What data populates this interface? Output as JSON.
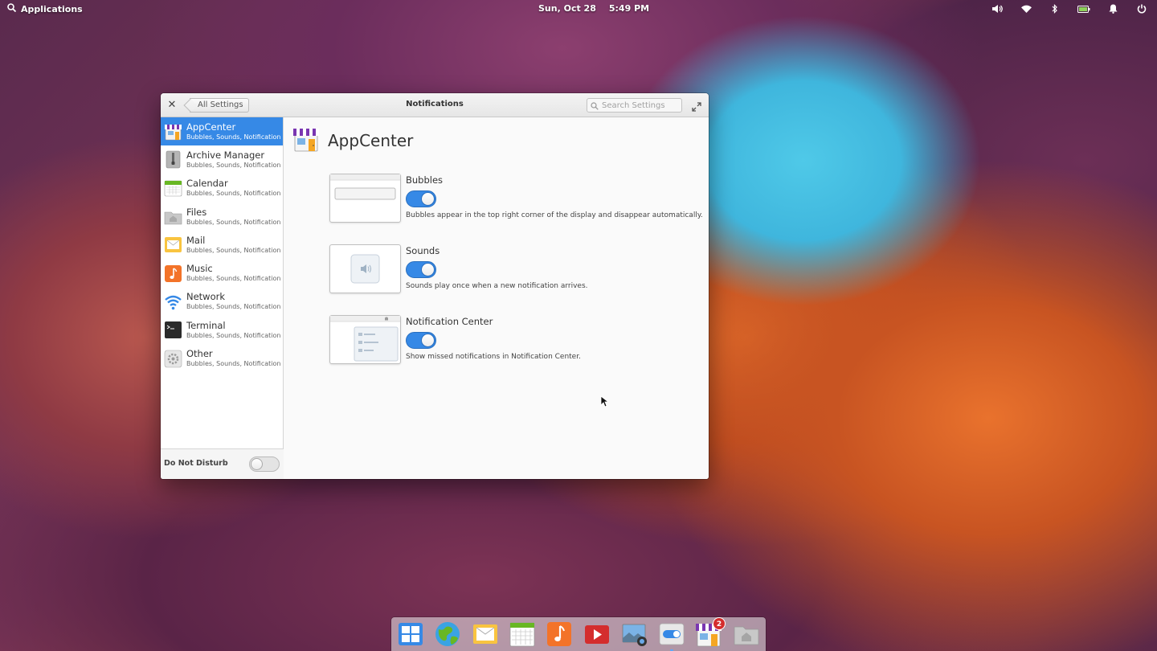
{
  "panel": {
    "applications_label": "Applications",
    "date": "Sun, Oct 28",
    "time": "5:49 PM"
  },
  "window": {
    "title": "Notifications",
    "back_label": "All Settings",
    "search_placeholder": "Search Settings"
  },
  "sidebar": {
    "items": [
      {
        "name": "AppCenter",
        "sub": "Bubbles, Sounds, Notification ...",
        "icon": "appcenter-icon"
      },
      {
        "name": "Archive Manager",
        "sub": "Bubbles, Sounds, Notification ...",
        "icon": "archive-manager-icon"
      },
      {
        "name": "Calendar",
        "sub": "Bubbles, Sounds, Notification ...",
        "icon": "calendar-icon"
      },
      {
        "name": "Files",
        "sub": "Bubbles, Sounds, Notification ...",
        "icon": "files-icon"
      },
      {
        "name": "Mail",
        "sub": "Bubbles, Sounds, Notification ...",
        "icon": "mail-icon"
      },
      {
        "name": "Music",
        "sub": "Bubbles, Sounds, Notification ...",
        "icon": "music-icon"
      },
      {
        "name": "Network",
        "sub": "Bubbles, Sounds, Notification ...",
        "icon": "network-icon"
      },
      {
        "name": "Terminal",
        "sub": "Bubbles, Sounds, Notification ...",
        "icon": "terminal-icon"
      },
      {
        "name": "Other",
        "sub": "Bubbles, Sounds, Notification ...",
        "icon": "other-icon"
      }
    ],
    "selected": "AppCenter",
    "dnd_label": "Do Not Disturb",
    "dnd_on": false
  },
  "main": {
    "app_title": "AppCenter",
    "settings": [
      {
        "title": "Bubbles",
        "description": "Bubbles appear in the top right corner of the display and disappear automatically.",
        "on": true
      },
      {
        "title": "Sounds",
        "description": "Sounds play once when a new notification arrives.",
        "on": true
      },
      {
        "title": "Notification Center",
        "description": "Show missed notifications in Notification Center.",
        "on": true
      }
    ]
  },
  "dock": {
    "items": [
      "multitasking-view-icon",
      "web-browser-icon",
      "mail-icon",
      "calendar-icon",
      "music-icon",
      "videos-icon",
      "photos-icon",
      "system-settings-icon",
      "appcenter-icon",
      "files-icon"
    ],
    "appcenter_badge": "2"
  },
  "colors": {
    "accent": "#3689e6"
  }
}
